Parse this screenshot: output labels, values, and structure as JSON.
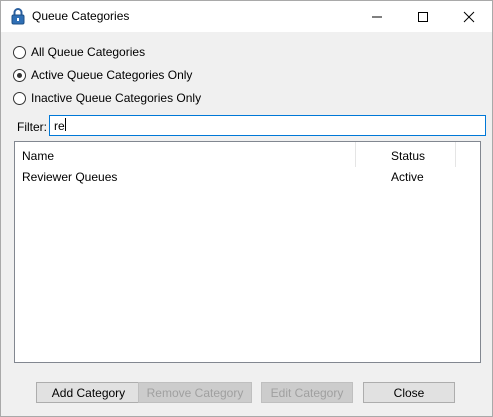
{
  "window": {
    "title": "Queue Categories",
    "icon": "lock-icon"
  },
  "options": [
    {
      "label": "All Queue Categories",
      "selected": false
    },
    {
      "label": "Active Queue Categories Only",
      "selected": true
    },
    {
      "label": "Inactive Queue Categories Only",
      "selected": false
    }
  ],
  "filter": {
    "label": "Filter:",
    "value": "re"
  },
  "list": {
    "columns": [
      "Name",
      "Status"
    ],
    "rows": [
      {
        "name": "Reviewer Queues",
        "status": "Active"
      }
    ]
  },
  "buttons": {
    "add": "Add Category",
    "remove": "Remove Category",
    "edit": "Edit Category",
    "close": "Close"
  },
  "colors": {
    "accent": "#0078d7",
    "disabled_text": "#a0a0a0"
  }
}
